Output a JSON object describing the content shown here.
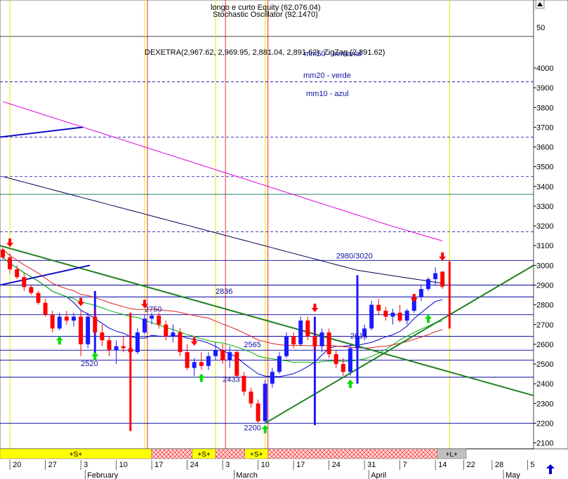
{
  "header": {
    "line1": "longo e curto Equity (62,076.04)",
    "line2": "Stochastic Oscillator (92.1470)",
    "osc_tick": "50",
    "security": "DEXETRA(2,967.62, 2,969.95, 2,881.04, 2,891.62), ZigZag (2,891.62)",
    "legend": [
      "mm50 - semanal",
      "mm20 - verde",
      "mm10 - azul"
    ]
  },
  "colors": {
    "bull": "#1a1aff",
    "bear": "#ff0000",
    "mm50_weekly": "#000050",
    "mm20": "#00b000",
    "mm10": "#0000c8",
    "long_ma": "#e000e0",
    "red_ma": "#e02020",
    "trendline": "#208020",
    "hline": "#0000a0",
    "vline_red": "#e00000",
    "vline_yellow": "#e6e600",
    "phase_fill": "#ffff00",
    "phase_hatch": "#ff4040",
    "phase_gray": "#c0c0c0"
  },
  "chart_data": {
    "type": "candlestick",
    "y_range": [
      2070,
      4160
    ],
    "y_ticks": [
      2100,
      2200,
      2300,
      2400,
      2500,
      2600,
      2700,
      2800,
      2900,
      3000,
      3100,
      3200,
      3300,
      3400,
      3500,
      3600,
      3700,
      3800,
      3900,
      4000
    ],
    "x_ticks": [
      {
        "label": "20",
        "i": 1
      },
      {
        "label": "27",
        "i": 6
      },
      {
        "label": "3",
        "i": 11
      },
      {
        "label": "10",
        "i": 16
      },
      {
        "label": "17",
        "i": 21
      },
      {
        "label": "24",
        "i": 26
      },
      {
        "label": "3",
        "i": 31
      },
      {
        "label": "10",
        "i": 36
      },
      {
        "label": "17",
        "i": 41
      },
      {
        "label": "24",
        "i": 46
      },
      {
        "label": "31",
        "i": 51
      },
      {
        "label": "7",
        "i": 56
      },
      {
        "label": "14",
        "i": 61
      },
      {
        "label": "22",
        "i": 65
      },
      {
        "label": "28",
        "i": 69
      },
      {
        "label": "5",
        "i": 74
      }
    ],
    "months": [
      {
        "label": "February",
        "i": 12
      },
      {
        "label": "March",
        "i": 33
      },
      {
        "label": "April",
        "i": 52
      },
      {
        "label": "May",
        "i": 71
      }
    ],
    "candles": [
      [
        3080,
        3090,
        3030,
        3040
      ],
      [
        3040,
        3060,
        2960,
        2980
      ],
      [
        2980,
        3000,
        2930,
        2940
      ],
      [
        2940,
        2960,
        2870,
        2890
      ],
      [
        2890,
        2900,
        2850,
        2860
      ],
      [
        2860,
        2870,
        2800,
        2810
      ],
      [
        2810,
        2830,
        2740,
        2750
      ],
      [
        2750,
        2770,
        2660,
        2680
      ],
      [
        2680,
        2760,
        2670,
        2740
      ],
      [
        2740,
        2770,
        2700,
        2720
      ],
      [
        2720,
        2760,
        2690,
        2740
      ],
      [
        2740,
        2770,
        2540,
        2600
      ],
      [
        2600,
        2760,
        2580,
        2740
      ],
      [
        2740,
        2780,
        2640,
        2660
      ],
      [
        2660,
        2700,
        2590,
        2620
      ],
      [
        2620,
        2640,
        2540,
        2570
      ],
      [
        2570,
        2620,
        2500,
        2590
      ],
      [
        2590,
        2640,
        2560,
        2580
      ],
      [
        2580,
        2610,
        2540,
        2560
      ],
      [
        2560,
        2680,
        2550,
        2660
      ],
      [
        2660,
        2750,
        2650,
        2730
      ],
      [
        2730,
        2760,
        2700,
        2745
      ],
      [
        2745,
        2760,
        2680,
        2700
      ],
      [
        2700,
        2720,
        2620,
        2640
      ],
      [
        2640,
        2700,
        2610,
        2660
      ],
      [
        2660,
        2680,
        2540,
        2560
      ],
      [
        2560,
        2600,
        2470,
        2480
      ],
      [
        2480,
        2530,
        2440,
        2510
      ],
      [
        2510,
        2560,
        2470,
        2490
      ],
      [
        2490,
        2560,
        2470,
        2540
      ],
      [
        2540,
        2610,
        2520,
        2570
      ],
      [
        2570,
        2600,
        2500,
        2520
      ],
      [
        2520,
        2590,
        2480,
        2560
      ],
      [
        2560,
        2570,
        2430,
        2440
      ],
      [
        2440,
        2460,
        2340,
        2360
      ],
      [
        2360,
        2380,
        2280,
        2300
      ],
      [
        2300,
        2320,
        2200,
        2210
      ],
      [
        2210,
        2420,
        2200,
        2400
      ],
      [
        2400,
        2480,
        2380,
        2460
      ],
      [
        2460,
        2560,
        2450,
        2540
      ],
      [
        2540,
        2660,
        2530,
        2640
      ],
      [
        2640,
        2660,
        2580,
        2600
      ],
      [
        2600,
        2740,
        2590,
        2720
      ],
      [
        2720,
        2740,
        2620,
        2640
      ],
      [
        2640,
        2670,
        2560,
        2590
      ],
      [
        2590,
        2680,
        2560,
        2660
      ],
      [
        2660,
        2680,
        2530,
        2550
      ],
      [
        2550,
        2570,
        2480,
        2500
      ],
      [
        2500,
        2530,
        2440,
        2460
      ],
      [
        2460,
        2600,
        2440,
        2580
      ],
      [
        2580,
        2660,
        2570,
        2640
      ],
      [
        2640,
        2700,
        2620,
        2680
      ],
      [
        2680,
        2820,
        2670,
        2800
      ],
      [
        2800,
        2830,
        2750,
        2770
      ],
      [
        2770,
        2790,
        2720,
        2740
      ],
      [
        2740,
        2780,
        2700,
        2760
      ],
      [
        2760,
        2800,
        2710,
        2720
      ],
      [
        2720,
        2780,
        2700,
        2770
      ],
      [
        2770,
        2850,
        2760,
        2840
      ],
      [
        2840,
        2900,
        2820,
        2880
      ],
      [
        2880,
        2940,
        2870,
        2930
      ],
      [
        2930,
        2990,
        2900,
        2960
      ],
      [
        2968,
        2970,
        2881,
        2892
      ]
    ],
    "hlines": [
      3025,
      2900,
      2840,
      2750,
      2640,
      2570,
      2520,
      2433,
      2200
    ],
    "hlines_dashed": [
      3170,
      3450,
      3650,
      3930
    ],
    "level_labels": [
      {
        "text": "2980/3020",
        "i": 47,
        "v": 3035
      },
      {
        "text": "2836",
        "i": 30,
        "v": 2855
      },
      {
        "text": "2750",
        "i": 20,
        "v": 2765
      },
      {
        "text": "2614",
        "i": 49,
        "v": 2630
      },
      {
        "text": "2565",
        "i": 34,
        "v": 2585
      },
      {
        "text": "2520",
        "i": 11,
        "v": 2490
      },
      {
        "text": "2433",
        "i": 31,
        "v": 2410
      },
      {
        "text": "2200",
        "i": 34,
        "v": 2165
      }
    ],
    "signals_down": [
      [
        1,
        3100
      ],
      [
        11,
        2800
      ],
      [
        20,
        2790
      ],
      [
        27,
        2600
      ],
      [
        44,
        2770
      ],
      [
        58,
        2820
      ],
      [
        62,
        3030
      ]
    ],
    "signals_up": [
      [
        8,
        2620
      ],
      [
        13,
        2540
      ],
      [
        28,
        2430
      ],
      [
        37,
        2170
      ],
      [
        49,
        2400
      ],
      [
        60,
        2730
      ]
    ],
    "phases": [
      {
        "label": "+S+",
        "from": 0,
        "to": 26,
        "kind": "fill"
      },
      {
        "label": "",
        "from": 26,
        "to": 33,
        "kind": "hatch"
      },
      {
        "label": "+S+",
        "from": 33,
        "to": 37,
        "kind": "fill"
      },
      {
        "label": "",
        "from": 37,
        "to": 42,
        "kind": "hatch"
      },
      {
        "label": "+S+",
        "from": 42,
        "to": 46,
        "kind": "fill"
      },
      {
        "label": "",
        "from": 46,
        "to": 75,
        "kind": "hatch"
      },
      {
        "label": "+L+",
        "from": 75,
        "to": 80,
        "kind": "gray"
      }
    ]
  }
}
